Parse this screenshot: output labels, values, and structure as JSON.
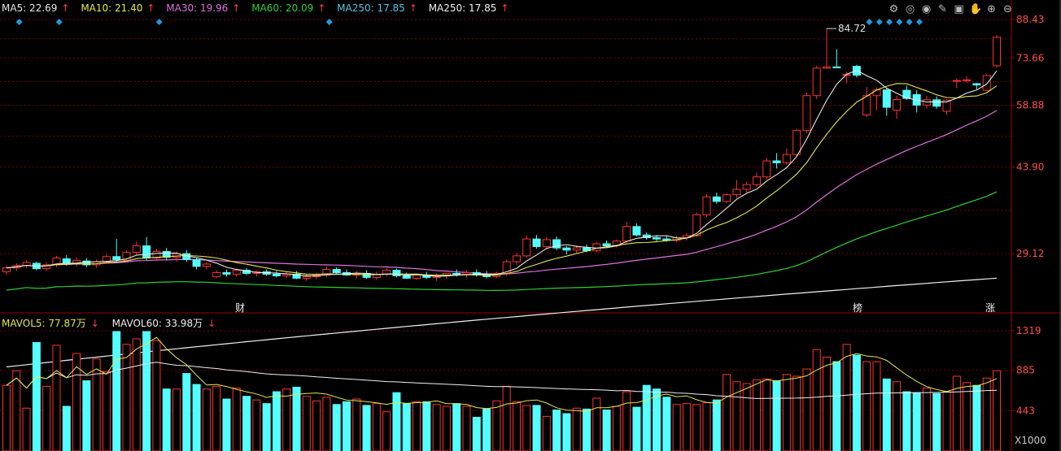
{
  "legend": {
    "ma5": {
      "label": "MA5: 22.69",
      "arrow": "↑",
      "color": "#e8e8e8"
    },
    "ma10": {
      "label": "MA10: 21.40",
      "arrow": "↑",
      "color": "#e6e64a"
    },
    "ma30": {
      "label": "MA30: 19.96",
      "arrow": "↑",
      "color": "#e070e0"
    },
    "ma60": {
      "label": "MA60: 20.09",
      "arrow": "↑",
      "color": "#2fd12f"
    },
    "ma250a": {
      "label": "MA250: 17.85",
      "arrow": "↑",
      "color": "#52c6e6"
    },
    "ma250b": {
      "label": "MA250: 17.85",
      "arrow": "↑",
      "color": "#f0f0f0"
    }
  },
  "vol_legend": {
    "mavol5": {
      "label": "MAVOL5: 77.87万",
      "arrow": "↓",
      "color": "#e6e64a"
    },
    "mavol60": {
      "label": "MAVOL60: 33.98万",
      "arrow": "↓",
      "color": "#f0f0f0"
    }
  },
  "toolbar_icons": [
    "gear-icon",
    "target-icon",
    "eye-icon",
    "pen-icon",
    "trash-icon",
    "hand-icon",
    "zoom-in-icon",
    "zoom-out-icon"
  ],
  "markers": {
    "cai": "财",
    "bang": "榜",
    "zhang": "涨"
  },
  "max_label": "84.72",
  "colors": {
    "up": "#ff3030",
    "down": "#54ffff",
    "grid": "#7a0000",
    "axis": "#9a0000",
    "diamond": "#1a9be0"
  },
  "chart_data": [
    {
      "type": "candlestick",
      "yticks": [
        88.43,
        73.66,
        58.88,
        43.9,
        29.12
      ],
      "ylim": [
        14.5,
        90.5
      ],
      "scale": "log",
      "max_annotation": 84.72,
      "ma_last": {
        "MA5": 22.69,
        "MA10": 21.4,
        "MA30": 19.96,
        "MA60": 20.09,
        "MA250": 17.85
      },
      "ohlc": [
        [
          26.7,
          27.5,
          26.3,
          27.2
        ],
        [
          27.2,
          27.8,
          26.8,
          27.5
        ],
        [
          27.5,
          28.2,
          27.2,
          27.9
        ],
        [
          27.8,
          28.0,
          26.9,
          27.1
        ],
        [
          27.1,
          27.9,
          26.8,
          27.6
        ],
        [
          27.6,
          28.8,
          27.3,
          28.5
        ],
        [
          28.4,
          28.9,
          27.5,
          27.8
        ],
        [
          27.8,
          28.6,
          27.4,
          28.2
        ],
        [
          28.1,
          28.5,
          27.3,
          27.6
        ],
        [
          27.6,
          28.3,
          27.2,
          28.0
        ],
        [
          28.0,
          29.0,
          27.8,
          28.7
        ],
        [
          28.7,
          31.2,
          28.0,
          28.3
        ],
        [
          28.2,
          29.6,
          27.9,
          29.3
        ],
        [
          29.3,
          30.8,
          28.9,
          30.2
        ],
        [
          30.2,
          31.5,
          28.2,
          28.5
        ],
        [
          28.5,
          29.8,
          28.1,
          29.4
        ],
        [
          29.4,
          29.9,
          28.2,
          28.6
        ],
        [
          28.6,
          29.4,
          28.0,
          29.1
        ],
        [
          29.1,
          29.6,
          28.0,
          28.3
        ],
        [
          28.3,
          28.5,
          27.0,
          27.4
        ],
        [
          27.4,
          28.0,
          27.0,
          27.7
        ],
        [
          26.1,
          26.9,
          25.9,
          26.6
        ],
        [
          26.6,
          27.0,
          26.1,
          26.4
        ],
        [
          26.4,
          27.1,
          26.1,
          26.9
        ],
        [
          26.9,
          27.2,
          26.3,
          26.5
        ],
        [
          26.5,
          26.9,
          26.1,
          26.7
        ],
        [
          26.7,
          27.0,
          26.2,
          26.4
        ],
        [
          26.4,
          26.8,
          26.0,
          26.2
        ],
        [
          26.2,
          26.7,
          25.9,
          26.4
        ],
        [
          26.4,
          26.8,
          25.8,
          25.9
        ],
        [
          25.9,
          26.4,
          25.6,
          26.1
        ],
        [
          26.1,
          26.6,
          25.8,
          26.3
        ],
        [
          26.3,
          27.4,
          26.0,
          27.0
        ],
        [
          27.0,
          27.3,
          26.4,
          26.6
        ],
        [
          26.6,
          27.0,
          26.2,
          26.3
        ],
        [
          26.3,
          26.8,
          25.9,
          26.5
        ],
        [
          26.5,
          26.9,
          25.8,
          26.0
        ],
        [
          26.0,
          26.7,
          25.7,
          26.4
        ],
        [
          26.4,
          27.2,
          26.1,
          26.9
        ],
        [
          26.9,
          27.1,
          26.0,
          26.2
        ],
        [
          26.2,
          26.6,
          25.8,
          25.9
        ],
        [
          25.9,
          26.5,
          25.7,
          26.3
        ],
        [
          26.3,
          26.7,
          25.8,
          26.0
        ],
        [
          26.0,
          26.5,
          25.6,
          26.2
        ],
        [
          26.2,
          26.6,
          25.8,
          26.5
        ],
        [
          26.5,
          27.0,
          26.1,
          26.4
        ],
        [
          26.4,
          26.9,
          26.0,
          26.6
        ],
        [
          26.6,
          27.0,
          26.1,
          26.3
        ],
        [
          26.3,
          26.8,
          25.9,
          26.1
        ],
        [
          26.1,
          26.7,
          25.9,
          26.5
        ],
        [
          26.5,
          28.3,
          26.2,
          28.0
        ],
        [
          28.0,
          29.2,
          27.6,
          28.8
        ],
        [
          28.8,
          31.7,
          28.5,
          31.2
        ],
        [
          31.2,
          31.8,
          29.8,
          30.1
        ],
        [
          30.1,
          31.5,
          29.7,
          31.1
        ],
        [
          31.1,
          31.6,
          29.6,
          29.9
        ],
        [
          29.9,
          30.2,
          29.0,
          29.6
        ],
        [
          29.6,
          30.3,
          29.1,
          29.9
        ],
        [
          29.9,
          30.4,
          29.3,
          29.5
        ],
        [
          29.5,
          30.8,
          29.3,
          30.5
        ],
        [
          30.5,
          31.0,
          30.0,
          30.2
        ],
        [
          30.2,
          31.1,
          30.0,
          30.9
        ],
        [
          30.9,
          33.8,
          30.6,
          33.1
        ],
        [
          33.1,
          33.6,
          31.6,
          31.8
        ],
        [
          31.8,
          32.2,
          31.1,
          31.4
        ],
        [
          31.4,
          31.8,
          30.9,
          31.2
        ],
        [
          31.2,
          31.6,
          30.8,
          31.0
        ],
        [
          31.0,
          31.7,
          30.7,
          31.4
        ],
        [
          31.4,
          32.1,
          31.0,
          31.7
        ],
        [
          31.7,
          35.4,
          31.5,
          35.0
        ],
        [
          35.0,
          38.6,
          34.6,
          38.1
        ],
        [
          38.1,
          38.9,
          36.9,
          37.3
        ],
        [
          37.3,
          38.8,
          37.0,
          38.5
        ],
        [
          38.5,
          41.3,
          37.9,
          39.5
        ],
        [
          39.5,
          40.9,
          38.9,
          40.4
        ],
        [
          40.4,
          42.8,
          40.0,
          41.9
        ],
        [
          41.9,
          45.8,
          41.4,
          45.2
        ],
        [
          45.2,
          46.9,
          43.6,
          44.8
        ],
        [
          44.8,
          47.9,
          44.4,
          46.6
        ],
        [
          46.6,
          52.7,
          46.2,
          52.2
        ],
        [
          52.2,
          62.5,
          51.6,
          61.6
        ],
        [
          61.6,
          71.0,
          60.6,
          70.2
        ],
        [
          70.2,
          84.72,
          70.0,
          70.6
        ],
        [
          70.6,
          76.8,
          70.3,
          70.5
        ],
        [
          68.1,
          69.0,
          65.4,
          68.1
        ],
        [
          70.8,
          71.3,
          67.1,
          67.9
        ],
        [
          56.2,
          64.2,
          55.6,
          61.6
        ],
        [
          61.6,
          64.0,
          57.5,
          63.3
        ],
        [
          63.3,
          63.8,
          56.0,
          58.3
        ],
        [
          57.5,
          61.6,
          55.2,
          60.5
        ],
        [
          63.2,
          64.6,
          60.4,
          60.8
        ],
        [
          61.9,
          63.2,
          56.9,
          58.9
        ],
        [
          58.9,
          61.6,
          57.9,
          60.4
        ],
        [
          60.4,
          61.4,
          57.9,
          58.6
        ],
        [
          57.2,
          60.6,
          56.3,
          60.3
        ],
        [
          66.2,
          66.8,
          63.9,
          66.2
        ],
        [
          66.2,
          67.5,
          65.4,
          66.4
        ],
        [
          65.2,
          65.5,
          63.5,
          64.8
        ],
        [
          63.2,
          68.1,
          62.9,
          67.8
        ],
        [
          71.0,
          82.1,
          70.5,
          81.3
        ]
      ],
      "volume_yticks": [
        1319,
        885,
        443
      ],
      "volume_unit": "X1000",
      "volume": [
        720,
        880,
        470,
        1190,
        710,
        1160,
        490,
        1070,
        770,
        1010,
        870,
        1310,
        1170,
        1230,
        1310,
        1210,
        680,
        680,
        850,
        730,
        680,
        710,
        570,
        690,
        600,
        560,
        520,
        650,
        680,
        700,
        600,
        550,
        590,
        510,
        540,
        570,
        500,
        520,
        430,
        640,
        520,
        540,
        540,
        510,
        490,
        520,
        490,
        370,
        460,
        550,
        710,
        540,
        500,
        500,
        380,
        450,
        410,
        470,
        460,
        580,
        450,
        490,
        650,
        480,
        720,
        680,
        590,
        510,
        520,
        510,
        530,
        560,
        840,
        760,
        740,
        780,
        790,
        770,
        840,
        820,
        900,
        1110,
        1030,
        980,
        1170,
        1050,
        980,
        980,
        790,
        760,
        650,
        640,
        690,
        630,
        650,
        820,
        750,
        720,
        800,
        880
      ]
    }
  ]
}
